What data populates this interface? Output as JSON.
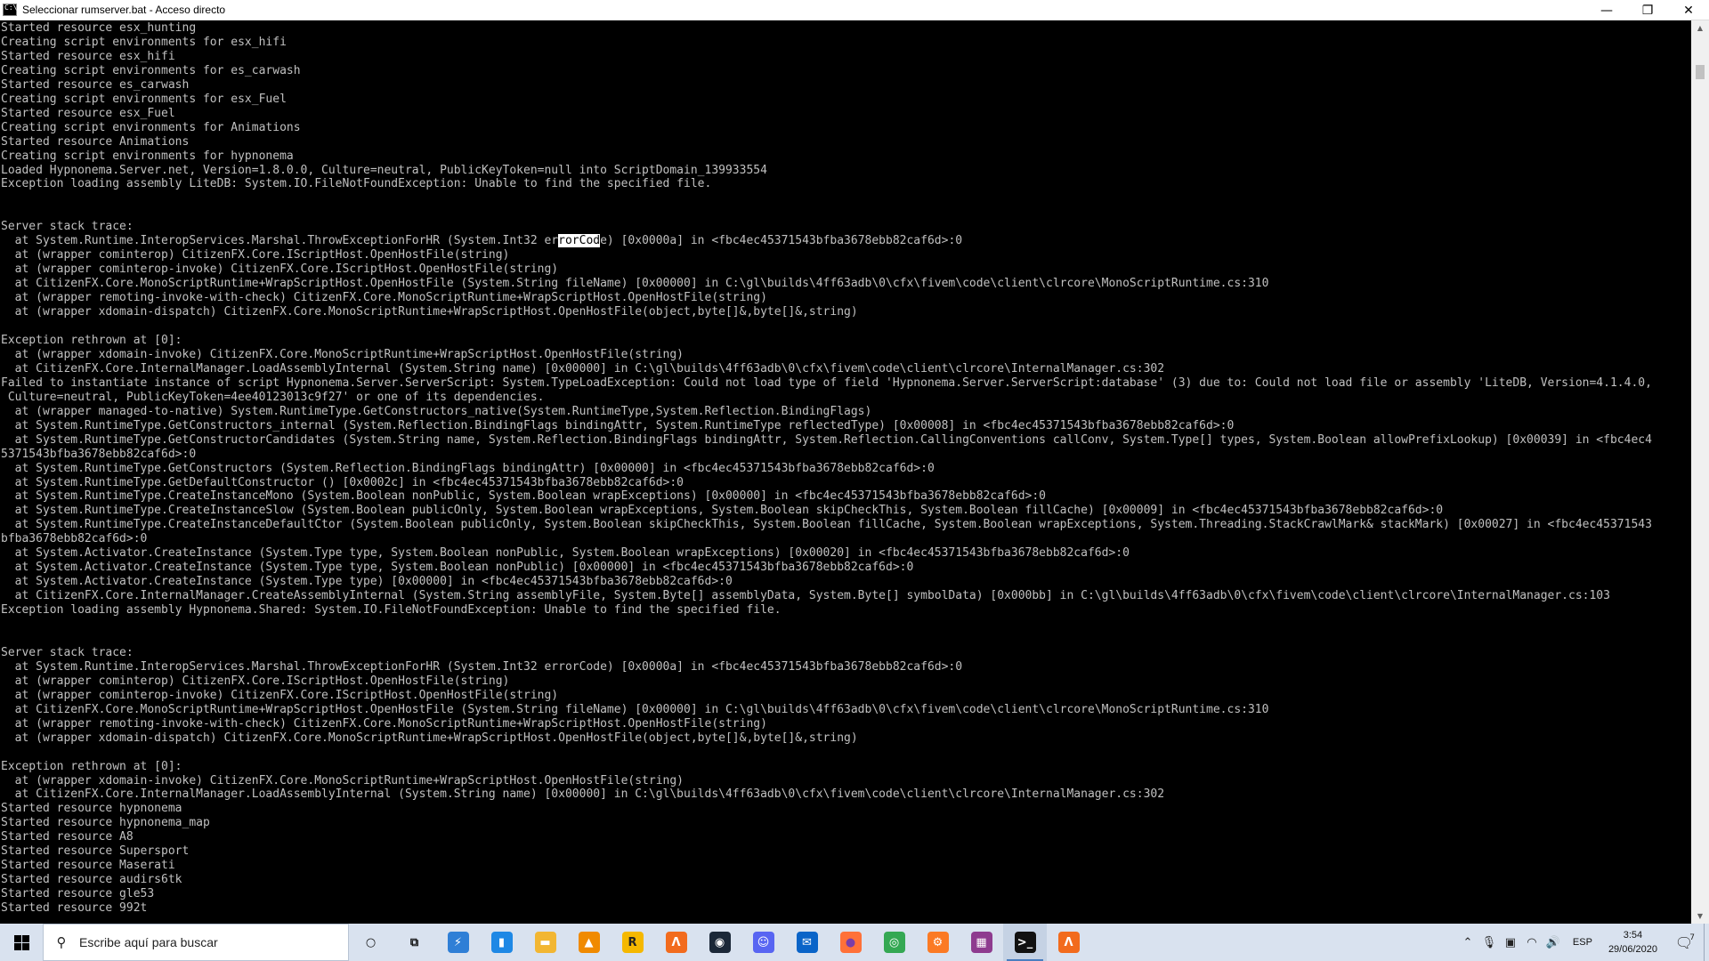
{
  "window": {
    "title": "Seleccionar rumserver.bat - Acceso directo",
    "minimize": "—",
    "maximize": "❐",
    "close": "✕"
  },
  "console": {
    "lines_before_selection": [
      "Started resource esx_hunting",
      "Creating script environments for esx_hifi",
      "Started resource esx_hifi",
      "Creating script environments for es_carwash",
      "Started resource es_carwash",
      "Creating script environments for esx_Fuel",
      "Started resource esx_Fuel",
      "Creating script environments for Animations",
      "Started resource Animations",
      "Creating script environments for hypnonema",
      "Loaded Hypnonema.Server.net, Version=1.8.0.0, Culture=neutral, PublicKeyToken=null into ScriptDomain_139933554",
      "Exception loading assembly LiteDB: System.IO.FileNotFoundException: Unable to find the specified file.",
      "",
      "",
      "Server stack trace:"
    ],
    "selection_line": {
      "before": "  at System.Runtime.InteropServices.Marshal.ThrowExceptionForHR (System.Int32 er",
      "selected": "rorCod",
      "after": "e) [0x0000a] in <fbc4ec45371543bfba3678ebb82caf6d>:0"
    },
    "lines_after_selection": [
      "  at (wrapper cominterop) CitizenFX.Core.IScriptHost.OpenHostFile(string)",
      "  at (wrapper cominterop-invoke) CitizenFX.Core.IScriptHost.OpenHostFile(string)",
      "  at CitizenFX.Core.MonoScriptRuntime+WrapScriptHost.OpenHostFile (System.String fileName) [0x00000] in C:\\gl\\builds\\4ff63adb\\0\\cfx\\fivem\\code\\client\\clrcore\\MonoScriptRuntime.cs:310",
      "  at (wrapper remoting-invoke-with-check) CitizenFX.Core.MonoScriptRuntime+WrapScriptHost.OpenHostFile(string)",
      "  at (wrapper xdomain-dispatch) CitizenFX.Core.MonoScriptRuntime+WrapScriptHost.OpenHostFile(object,byte[]&,byte[]&,string)",
      "",
      "Exception rethrown at [0]:",
      "  at (wrapper xdomain-invoke) CitizenFX.Core.MonoScriptRuntime+WrapScriptHost.OpenHostFile(string)",
      "  at CitizenFX.Core.InternalManager.LoadAssemblyInternal (System.String name) [0x00000] in C:\\gl\\builds\\4ff63adb\\0\\cfx\\fivem\\code\\client\\clrcore\\InternalManager.cs:302",
      "Failed to instantiate instance of script Hypnonema.Server.ServerScript: System.TypeLoadException: Could not load type of field 'Hypnonema.Server.ServerScript:database' (3) due to: Could not load file or assembly 'LiteDB, Version=4.1.4.0,",
      " Culture=neutral, PublicKeyToken=4ee40123013c9f27' or one of its dependencies.",
      "  at (wrapper managed-to-native) System.RuntimeType.GetConstructors_native(System.RuntimeType,System.Reflection.BindingFlags)",
      "  at System.RuntimeType.GetConstructors_internal (System.Reflection.BindingFlags bindingAttr, System.RuntimeType reflectedType) [0x00008] in <fbc4ec45371543bfba3678ebb82caf6d>:0",
      "  at System.RuntimeType.GetConstructorCandidates (System.String name, System.Reflection.BindingFlags bindingAttr, System.Reflection.CallingConventions callConv, System.Type[] types, System.Boolean allowPrefixLookup) [0x00039] in <fbc4ec4",
      "5371543bfba3678ebb82caf6d>:0",
      "  at System.RuntimeType.GetConstructors (System.Reflection.BindingFlags bindingAttr) [0x00000] in <fbc4ec45371543bfba3678ebb82caf6d>:0",
      "  at System.RuntimeType.GetDefaultConstructor () [0x0002c] in <fbc4ec45371543bfba3678ebb82caf6d>:0",
      "  at System.RuntimeType.CreateInstanceMono (System.Boolean nonPublic, System.Boolean wrapExceptions) [0x00000] in <fbc4ec45371543bfba3678ebb82caf6d>:0",
      "  at System.RuntimeType.CreateInstanceSlow (System.Boolean publicOnly, System.Boolean wrapExceptions, System.Boolean skipCheckThis, System.Boolean fillCache) [0x00009] in <fbc4ec45371543bfba3678ebb82caf6d>:0",
      "  at System.RuntimeType.CreateInstanceDefaultCtor (System.Boolean publicOnly, System.Boolean skipCheckThis, System.Boolean fillCache, System.Boolean wrapExceptions, System.Threading.StackCrawlMark& stackMark) [0x00027] in <fbc4ec45371543",
      "bfba3678ebb82caf6d>:0",
      "  at System.Activator.CreateInstance (System.Type type, System.Boolean nonPublic, System.Boolean wrapExceptions) [0x00020] in <fbc4ec45371543bfba3678ebb82caf6d>:0",
      "  at System.Activator.CreateInstance (System.Type type, System.Boolean nonPublic) [0x00000] in <fbc4ec45371543bfba3678ebb82caf6d>:0",
      "  at System.Activator.CreateInstance (System.Type type) [0x00000] in <fbc4ec45371543bfba3678ebb82caf6d>:0",
      "  at CitizenFX.Core.InternalManager.CreateAssemblyInternal (System.String assemblyFile, System.Byte[] assemblyData, System.Byte[] symbolData) [0x000bb] in C:\\gl\\builds\\4ff63adb\\0\\cfx\\fivem\\code\\client\\clrcore\\InternalManager.cs:103",
      "Exception loading assembly Hypnonema.Shared: System.IO.FileNotFoundException: Unable to find the specified file.",
      "",
      "",
      "Server stack trace:",
      "  at System.Runtime.InteropServices.Marshal.ThrowExceptionForHR (System.Int32 errorCode) [0x0000a] in <fbc4ec45371543bfba3678ebb82caf6d>:0",
      "  at (wrapper cominterop) CitizenFX.Core.IScriptHost.OpenHostFile(string)",
      "  at (wrapper cominterop-invoke) CitizenFX.Core.IScriptHost.OpenHostFile(string)",
      "  at CitizenFX.Core.MonoScriptRuntime+WrapScriptHost.OpenHostFile (System.String fileName) [0x00000] in C:\\gl\\builds\\4ff63adb\\0\\cfx\\fivem\\code\\client\\clrcore\\MonoScriptRuntime.cs:310",
      "  at (wrapper remoting-invoke-with-check) CitizenFX.Core.MonoScriptRuntime+WrapScriptHost.OpenHostFile(string)",
      "  at (wrapper xdomain-dispatch) CitizenFX.Core.MonoScriptRuntime+WrapScriptHost.OpenHostFile(object,byte[]&,byte[]&,string)",
      "",
      "Exception rethrown at [0]:",
      "  at (wrapper xdomain-invoke) CitizenFX.Core.MonoScriptRuntime+WrapScriptHost.OpenHostFile(string)",
      "  at CitizenFX.Core.InternalManager.LoadAssemblyInternal (System.String name) [0x00000] in C:\\gl\\builds\\4ff63adb\\0\\cfx\\fivem\\code\\client\\clrcore\\InternalManager.cs:302",
      "Started resource hypnonema",
      "Started resource hypnonema_map",
      "Started resource A8",
      "Started resource Supersport",
      "Started resource Maserati",
      "Started resource audirs6tk",
      "Started resource gle53",
      "Started resource 992t"
    ]
  },
  "colors": {
    "console_bg": "#000000",
    "console_fg": "#c0c0c0",
    "taskbar_bg": "#d9e2ef",
    "active_indicator": "#4a7ec0"
  },
  "taskbar": {
    "search_placeholder": "Escribe aquí para buscar",
    "apps": [
      {
        "name": "cortana-icon",
        "glyph": "○",
        "color": "transparent",
        "fg": "#111"
      },
      {
        "name": "task-view-icon",
        "glyph": "⧉",
        "color": "transparent",
        "fg": "#111"
      },
      {
        "name": "thunderbolt-app-icon",
        "glyph": "⚡",
        "color": "#2f7fd6",
        "fg": "#fff"
      },
      {
        "name": "file-app-icon",
        "glyph": "▮",
        "color": "#1e88e5",
        "fg": "#fff"
      },
      {
        "name": "file-explorer-icon",
        "glyph": "▬",
        "color": "#f2b632",
        "fg": "#fff"
      },
      {
        "name": "vlc-icon",
        "glyph": "▲",
        "color": "#f08a00",
        "fg": "#fff"
      },
      {
        "name": "rockstar-icon",
        "glyph": "R",
        "color": "#f5b800",
        "fg": "#222"
      },
      {
        "name": "xampp-like-icon",
        "glyph": "Λ",
        "color": "#f26b1d",
        "fg": "#fff"
      },
      {
        "name": "steam-icon",
        "glyph": "◉",
        "color": "#1b2838",
        "fg": "#fff"
      },
      {
        "name": "discord-icon",
        "glyph": "☺",
        "color": "#5865f2",
        "fg": "#fff"
      },
      {
        "name": "mail-icon",
        "glyph": "✉",
        "color": "#0a64c8",
        "fg": "#fff"
      },
      {
        "name": "firefox-icon",
        "glyph": "●",
        "color": "#ff7139",
        "fg": "#7a3ea8"
      },
      {
        "name": "chrome-icon",
        "glyph": "◎",
        "color": "#34a853",
        "fg": "#fff"
      },
      {
        "name": "xampp-icon",
        "glyph": "⚙",
        "color": "#fb7a24",
        "fg": "#fff"
      },
      {
        "name": "winrar-icon",
        "glyph": "▦",
        "color": "#8e3b8f",
        "fg": "#fff"
      },
      {
        "name": "command-prompt-icon",
        "glyph": ">_",
        "color": "#111",
        "fg": "#fff",
        "active": true
      },
      {
        "name": "fivem-icon",
        "glyph": "Λ",
        "color": "#f26b1d",
        "fg": "#fff"
      }
    ]
  },
  "tray": {
    "language": "ESP",
    "time": "3:54",
    "date": "29/06/2020",
    "notifications_count": "7",
    "icons": [
      {
        "name": "chevron-up-icon",
        "glyph": "⌃"
      },
      {
        "name": "microphone-icon",
        "glyph": "🎙"
      },
      {
        "name": "device-icon",
        "glyph": "▣"
      },
      {
        "name": "wifi-icon",
        "glyph": "◠"
      },
      {
        "name": "volume-icon",
        "glyph": "🔊"
      }
    ]
  }
}
